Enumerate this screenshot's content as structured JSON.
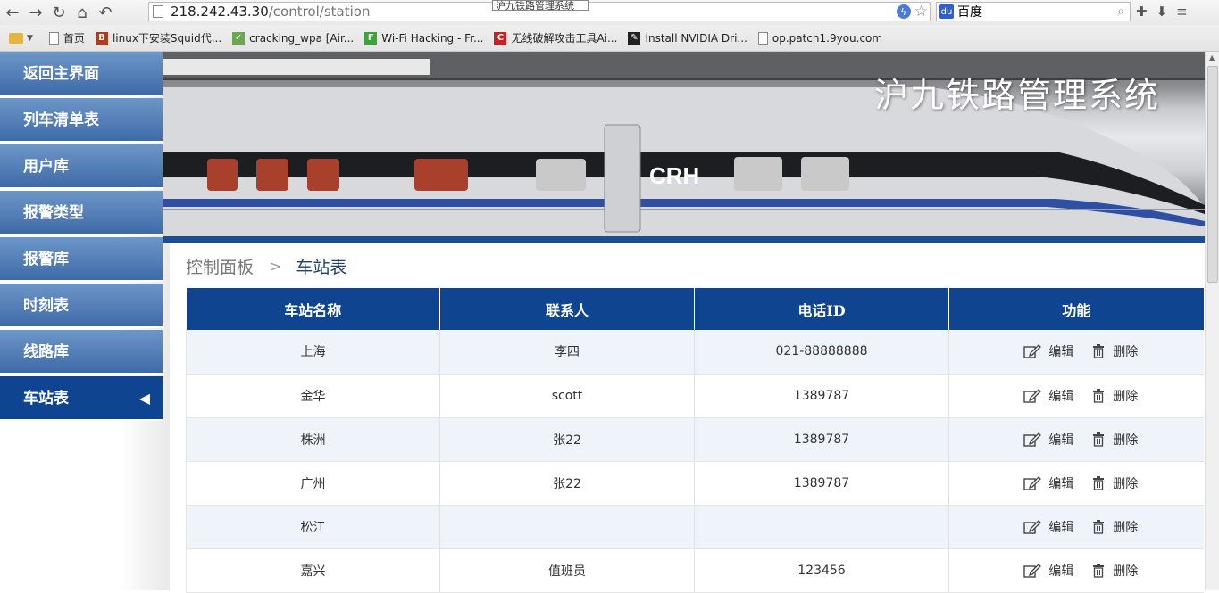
{
  "browser": {
    "url_host": "218.242.43.30",
    "url_path": "/control/station",
    "tooltip": "沪九铁路管理系统",
    "search_engine": "百度",
    "bookmarks": [
      {
        "label": "首页",
        "color": "#888888",
        "glyph": ""
      },
      {
        "label": "linux下安装Squid代...",
        "color": "#b23a1d",
        "glyph": "B"
      },
      {
        "label": "cracking_wpa [Air...",
        "color": "#6aa84f",
        "glyph": "✓"
      },
      {
        "label": "Wi-Fi Hacking - Fr...",
        "color": "#3aa63a",
        "glyph": "F"
      },
      {
        "label": "无线破解攻击工具Ai...",
        "color": "#cc1f1f",
        "glyph": "C"
      },
      {
        "label": "Install NVIDIA Dri...",
        "color": "#222222",
        "glyph": "✎"
      },
      {
        "label": "op.patch1.9you.com",
        "color": "#888888",
        "glyph": ""
      }
    ]
  },
  "sidebar": {
    "items": [
      {
        "label": "返回主界面",
        "active": false
      },
      {
        "label": "列车清单表",
        "active": false
      },
      {
        "label": "用户库",
        "active": false
      },
      {
        "label": "报警类型",
        "active": false
      },
      {
        "label": "报警库",
        "active": false
      },
      {
        "label": "时刻表",
        "active": false
      },
      {
        "label": "线路库",
        "active": false
      },
      {
        "label": "车站表",
        "active": true
      }
    ],
    "active_arrow": "◀"
  },
  "banner": {
    "title": "沪九铁路管理系统"
  },
  "breadcrumb": {
    "root": "控制面板",
    "separator": ">",
    "current": "车站表"
  },
  "table": {
    "headers": [
      "车站名称",
      "联系人",
      "电话ID",
      "功能"
    ],
    "edit_label": "编辑",
    "delete_label": "删除",
    "rows": [
      {
        "name": "上海",
        "contact": "李四",
        "phone": "021-88888888"
      },
      {
        "name": "金华",
        "contact": "scott",
        "phone": "1389787"
      },
      {
        "name": "株洲",
        "contact": "张22",
        "phone": "1389787"
      },
      {
        "name": "广州",
        "contact": "张22",
        "phone": "1389787"
      },
      {
        "name": "松江",
        "contact": "",
        "phone": ""
      },
      {
        "name": "嘉兴",
        "contact": "值班员",
        "phone": "123456"
      }
    ]
  },
  "colors": {
    "menu": "#4f7db8",
    "menu_active": "#0f4590",
    "table_header": "#0f4590",
    "row_alt": "#eef4f9"
  }
}
